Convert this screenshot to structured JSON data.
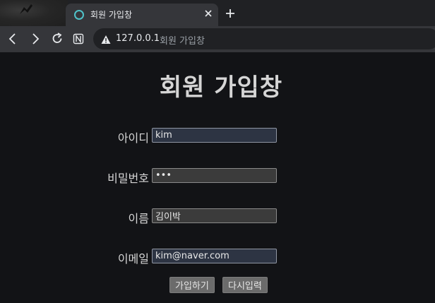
{
  "browser": {
    "tab": {
      "title": "회원 가입창"
    },
    "address": {
      "host": "127.0.0.1",
      "page_title": "회원 가입창"
    }
  },
  "form": {
    "heading": "회원 가입창",
    "fields": [
      {
        "label": "아이디",
        "value": "kim",
        "type": "text"
      },
      {
        "label": "비밀번호",
        "value": "abc",
        "type": "password"
      },
      {
        "label": "이름",
        "value": "김이박",
        "type": "text"
      },
      {
        "label": "이메일",
        "value": "kim@naver.com",
        "type": "text"
      }
    ],
    "submit_label": "가입하기",
    "reset_label": "다시입력"
  },
  "colors": {
    "background": "#121316",
    "tab_favicon": "#4fc2c9",
    "button": "#6b6b6b",
    "autofill_field": "#2d3443"
  },
  "icons": [
    "leaf-icon",
    "site-favicon-icon",
    "close-icon",
    "plus-icon",
    "back-icon",
    "forward-icon",
    "reload-icon",
    "reader-mode-icon",
    "warning-icon"
  ]
}
